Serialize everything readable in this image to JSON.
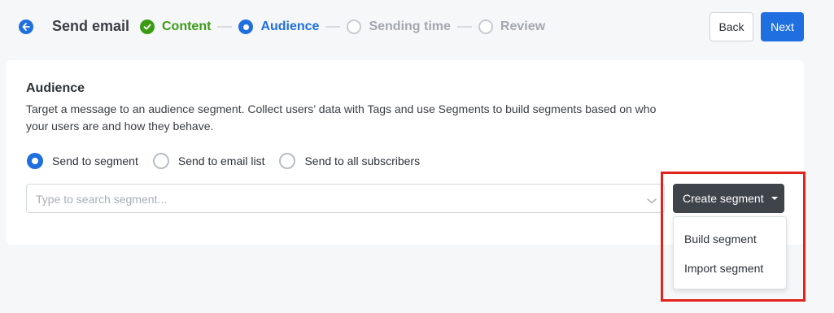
{
  "header": {
    "title": "Send email",
    "back_label": "Back",
    "next_label": "Next"
  },
  "steps": [
    {
      "label": "Content",
      "state": "done"
    },
    {
      "label": "Audience",
      "state": "active"
    },
    {
      "label": "Sending time",
      "state": "pending"
    },
    {
      "label": "Review",
      "state": "pending"
    }
  ],
  "audience": {
    "title": "Audience",
    "description": "Target a message to an audience segment. Collect users’ data with Tags and use Segments to build segments based on who your users are and how they behave.",
    "radios": [
      {
        "label": "Send to segment",
        "checked": true
      },
      {
        "label": "Send to email list",
        "checked": false
      },
      {
        "label": "Send to all subscribers",
        "checked": false
      }
    ],
    "search_placeholder": "Type to search segment...",
    "create_label": "Create segment",
    "menu": [
      "Build segment",
      "Import segment"
    ]
  },
  "colors": {
    "accent": "#1f6fe0",
    "success": "#3c9b15",
    "highlight": "#e0241c",
    "dark_button": "#3f444b"
  }
}
